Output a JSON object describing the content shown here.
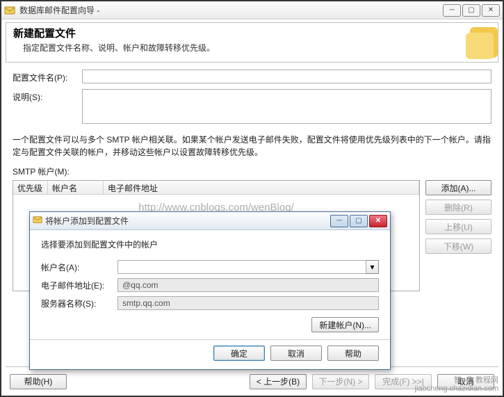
{
  "window": {
    "title": "数据库邮件配置向导 - "
  },
  "header": {
    "title": "新建配置文件",
    "subtitle": "指定配置文件名称、说明、帐户和故障转移优先级。"
  },
  "form": {
    "profile_name_label": "配置文件名(P):",
    "profile_name_value": "",
    "description_label": "说明(S):",
    "description_value": ""
  },
  "desc": "一个配置文件可以与多个 SMTP 帐户相关联。如果某个帐户发送电子邮件失败，配置文件将使用优先级列表中的下一个帐户。请指定与配置文件关联的帐户，并移动这些帐户以设置故障转移优先级。",
  "smtp": {
    "label": "SMTP 帐户(M):",
    "columns": {
      "priority": "优先级",
      "account": "帐户名",
      "email": "电子邮件地址"
    },
    "watermark": "http://www.cnblogs.com/wenBlog/",
    "buttons": {
      "add": "添加(A)...",
      "remove": "删除(R)",
      "up": "上移(U)",
      "down": "下移(W)"
    }
  },
  "footer": {
    "help": "帮助(H)",
    "prev": "< 上一步(B)",
    "next": "下一步(N) >",
    "finish": "完成(F) >>|",
    "cancel": "取消"
  },
  "dialog": {
    "title": "将帐户添加到配置文件",
    "message": "选择要添加到配置文件中的帐户",
    "account_label": "帐户名(A):",
    "account_value": "",
    "email_label": "电子邮件地址(E):",
    "email_value": "@qq.com",
    "server_label": "服务器名称(S):",
    "server_value": "smtp.qq.com",
    "new_account": "新建帐户(N)...",
    "ok": "确定",
    "cancel": "取消",
    "help": "帮助"
  },
  "site_watermark": {
    "line1": "智e典 教程网",
    "line2": "jiaocheng.chazidian.com"
  }
}
